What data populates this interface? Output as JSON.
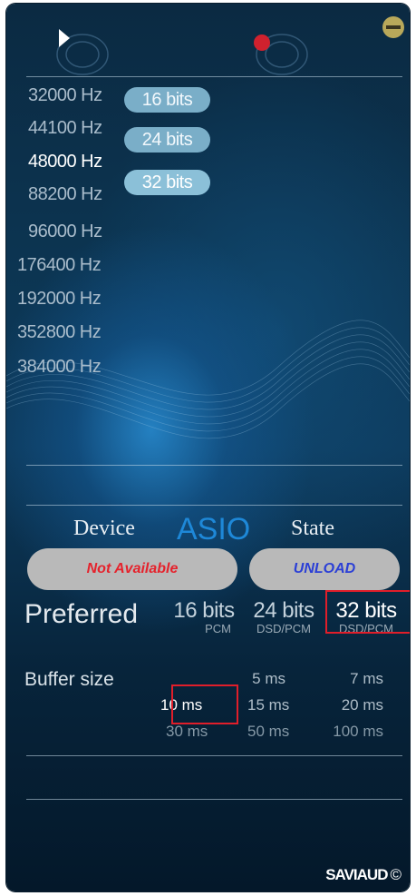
{
  "frequencies": [
    {
      "label": "32000 Hz"
    },
    {
      "label": "44100 Hz"
    },
    {
      "label": "48000 Hz"
    },
    {
      "label": "88200 Hz"
    },
    {
      "label": "96000 Hz"
    },
    {
      "label": "176400 Hz"
    },
    {
      "label": "192000 Hz"
    },
    {
      "label": "352800 Hz"
    },
    {
      "label": "384000 Hz"
    }
  ],
  "selected_frequency": "48000 Hz",
  "bit_depths": [
    {
      "label": "16 bits"
    },
    {
      "label": "24 bits"
    },
    {
      "label": "32 bits"
    }
  ],
  "selected_bit_depth": "32 bits",
  "asio": {
    "device_label": "Device",
    "title": "ASIO",
    "state_label": "State",
    "device_status": "Not Available",
    "state_action": "UNLOAD"
  },
  "preferred": {
    "label": "Preferred",
    "options": [
      {
        "bits": "16 bits",
        "format": "PCM"
      },
      {
        "bits": "24 bits",
        "format": "DSD/PCM"
      },
      {
        "bits": "32 bits",
        "format": "DSD/PCM"
      }
    ],
    "selected": "32 bits"
  },
  "buffer": {
    "label": "Buffer size",
    "options": [
      "5 ms",
      "7 ms",
      "10 ms",
      "15 ms",
      "20 ms",
      "30 ms",
      "50 ms",
      "100 ms"
    ],
    "selected": "10 ms"
  },
  "logo": {
    "text": "SAVIAUD",
    "suffix": "©"
  },
  "colors": {
    "accent": "#1e88d8",
    "record_dot": "#d0212e",
    "minimize": "#b8a85a",
    "device_status_text": "#e5222c",
    "state_action_text": "#2b3fd6",
    "highlight_box": "#e01e2a"
  }
}
